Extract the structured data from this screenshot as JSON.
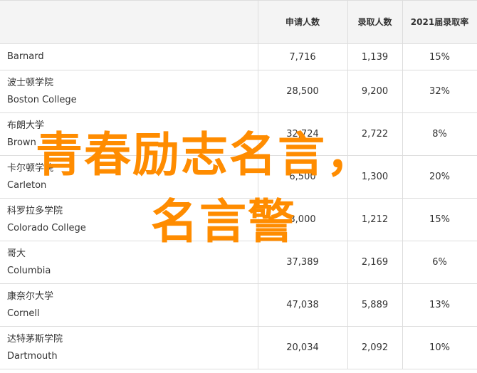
{
  "table": {
    "headers": {
      "school": "",
      "applicants": "申请人数",
      "admitted": "录取人数",
      "rate": "2021届录取率"
    },
    "rows": [
      {
        "zh": "",
        "en": "Barnard",
        "applicants": "7,716",
        "admitted": "1,139",
        "rate": "15%"
      },
      {
        "zh": "波士顿学院",
        "en": "Boston College",
        "applicants": "28,500",
        "admitted": "9,200",
        "rate": "32%"
      },
      {
        "zh": "布朗大学",
        "en": "Brown",
        "applicants": "32,724",
        "admitted": "2,722",
        "rate": "8%"
      },
      {
        "zh": "卡尔顿学院",
        "en": "Carleton",
        "applicants": "6,500",
        "admitted": "1,300",
        "rate": "20%"
      },
      {
        "zh": "科罗拉多学院",
        "en": "Colorado College",
        "applicants": "8,000",
        "admitted": "1,212",
        "rate": "15%"
      },
      {
        "zh": "哥大",
        "en": "Columbia",
        "applicants": "37,389",
        "admitted": "2,169",
        "rate": "6%"
      },
      {
        "zh": "康奈尔大学",
        "en": "Cornell",
        "applicants": "47,038",
        "admitted": "5,889",
        "rate": "13%"
      },
      {
        "zh": "达特茅斯学院",
        "en": "Dartmouth",
        "applicants": "20,034",
        "admitted": "2,092",
        "rate": "10%"
      }
    ]
  },
  "overlay": {
    "line1": "青春励志名言，",
    "line2": "名言警",
    "color": "#ff8c00"
  }
}
